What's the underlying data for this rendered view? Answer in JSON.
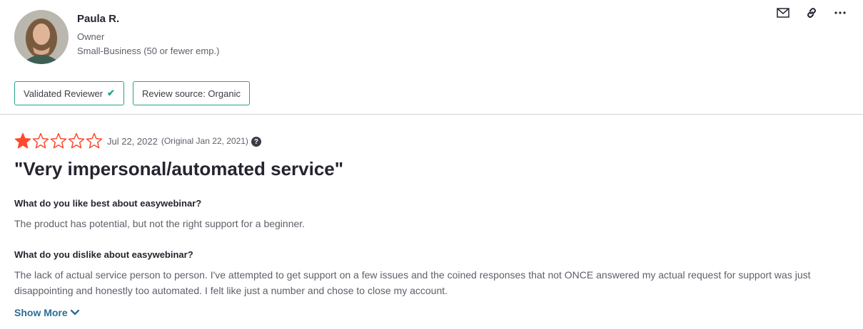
{
  "reviewer": {
    "name": "Paula R.",
    "role": "Owner",
    "company_size": "Small-Business (50 or fewer emp.)"
  },
  "actions": [
    {
      "icon": "mail-icon"
    },
    {
      "icon": "link-icon"
    },
    {
      "icon": "more-icon"
    }
  ],
  "badges": {
    "validated": "Validated Reviewer",
    "source": "Review source: Organic"
  },
  "review": {
    "rating": 1,
    "max_rating": 5,
    "date": "Jul 22, 2022",
    "original_date": "(Original Jan 22, 2021)",
    "help": "?",
    "title": "\"Very impersonal/automated service\"",
    "q1": "What do you like best about easywebinar?",
    "a1": "The product has potential, but not the right support for a beginner.",
    "q2": "What do you dislike about easywebinar?",
    "a2": "The lack of actual service person to person. I've attempted to get support on a few issues and the coined responses that not ONCE answered my actual request for support was just disappointing and honestly too automated. I felt like just a number and chose to close my account.",
    "show_more": "Show More"
  },
  "colors": {
    "star_filled": "#ff492c",
    "badge_border": "#27a38a",
    "link": "#2c6d96"
  }
}
